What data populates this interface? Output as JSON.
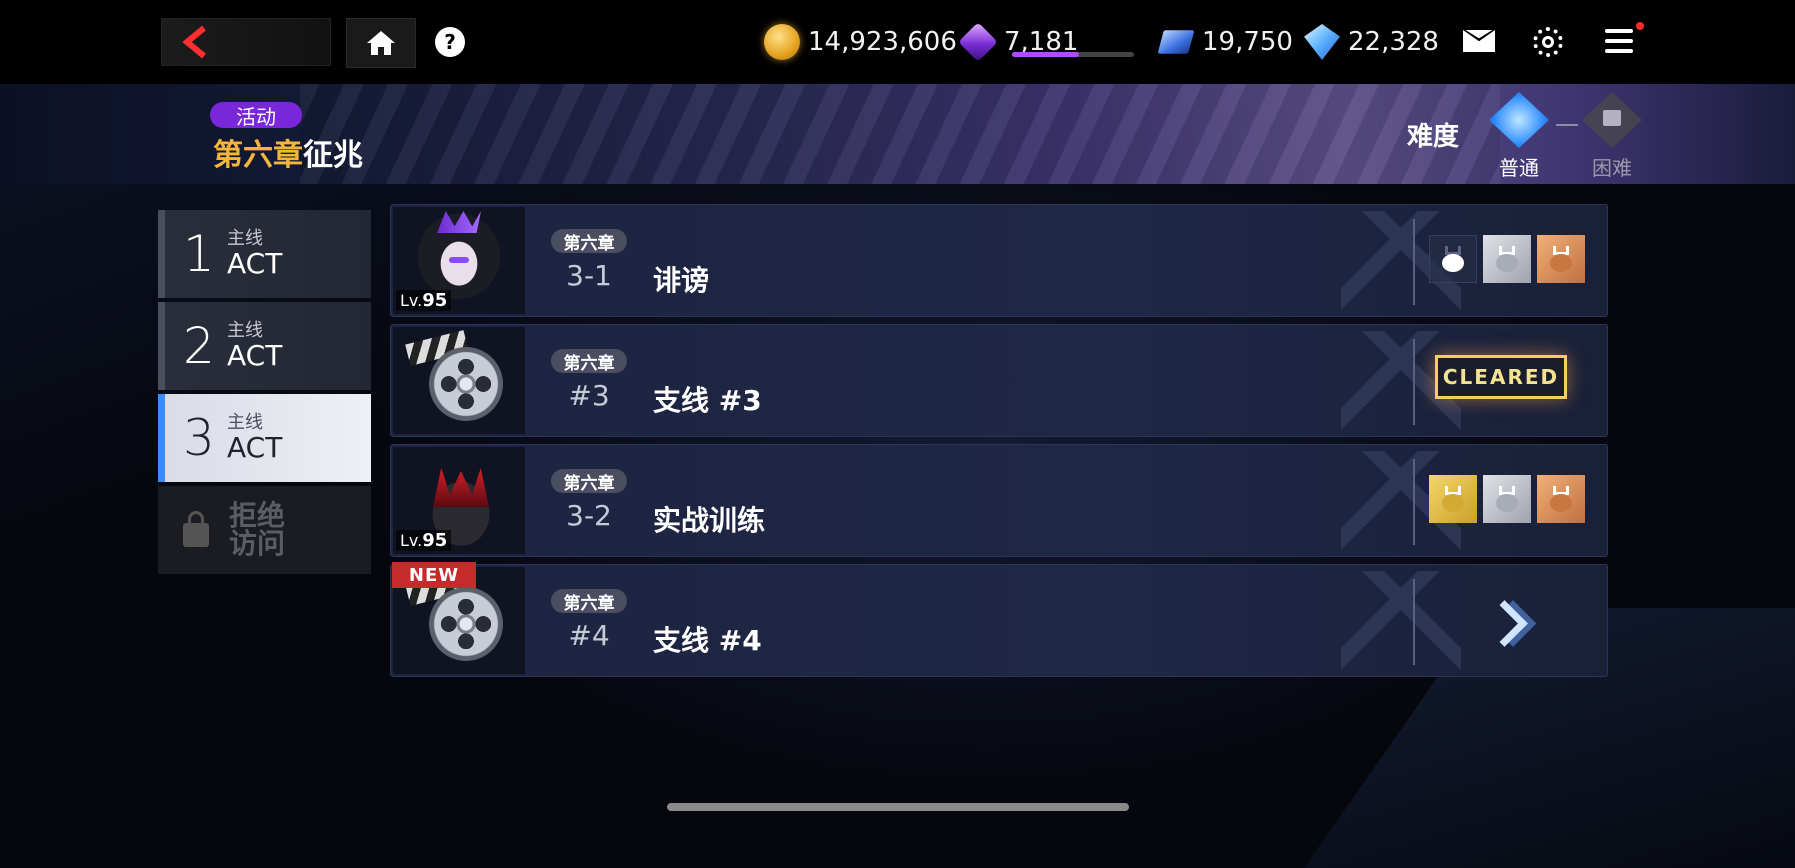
{
  "header": {
    "help_label": "?",
    "resources": [
      {
        "icon": "gold-coin-icon",
        "value": "14,923,606"
      },
      {
        "icon": "purple-cube-icon",
        "value": "7,181",
        "stamina_fraction": 0.55
      },
      {
        "icon": "blue-card-icon",
        "value": "19,750"
      },
      {
        "icon": "diamond-icon",
        "value": "22,328"
      }
    ]
  },
  "banner": {
    "event_badge": "活动",
    "chapter_highlight": "第六章",
    "chapter_rest": "征兆",
    "difficulty_label": "难度",
    "difficulties": [
      {
        "label": "普通",
        "selected": true
      },
      {
        "label": "困难",
        "locked": true
      }
    ]
  },
  "acts": [
    {
      "number": "1",
      "sub": "主线",
      "title": "ACT",
      "state": "normal"
    },
    {
      "number": "2",
      "sub": "主线",
      "title": "ACT",
      "state": "normal"
    },
    {
      "number": "3",
      "sub": "主线",
      "title": "ACT",
      "state": "active"
    },
    {
      "locked_text_line1": "拒绝",
      "locked_text_line2": "访问",
      "state": "locked"
    }
  ],
  "stages": [
    {
      "tag": "第六章",
      "code": "3-1",
      "name": "诽谤",
      "level_prefix": "Lv.",
      "level": "95",
      "thumb": "character-portrait",
      "medals": [
        "empty",
        "silver",
        "bronze"
      ]
    },
    {
      "tag": "第六章",
      "code": "#3",
      "name": "支线 #3",
      "thumb": "film-reel",
      "status": "CLEARED"
    },
    {
      "tag": "第六章",
      "code": "3-2",
      "name": "实战训练",
      "level_prefix": "Lv.",
      "level": "95",
      "thumb": "monster",
      "medals": [
        "gold",
        "silver",
        "bronze"
      ]
    },
    {
      "tag": "第六章",
      "code": "#4",
      "name": "支线 #4",
      "thumb": "film-reel",
      "badge": "NEW",
      "action": "go"
    }
  ],
  "colors": {
    "accent_blue": "#3b8bff",
    "event_purple": "#7a26d9",
    "chapter_gold": "#f3b53b",
    "new_red": "#c62b2b"
  }
}
